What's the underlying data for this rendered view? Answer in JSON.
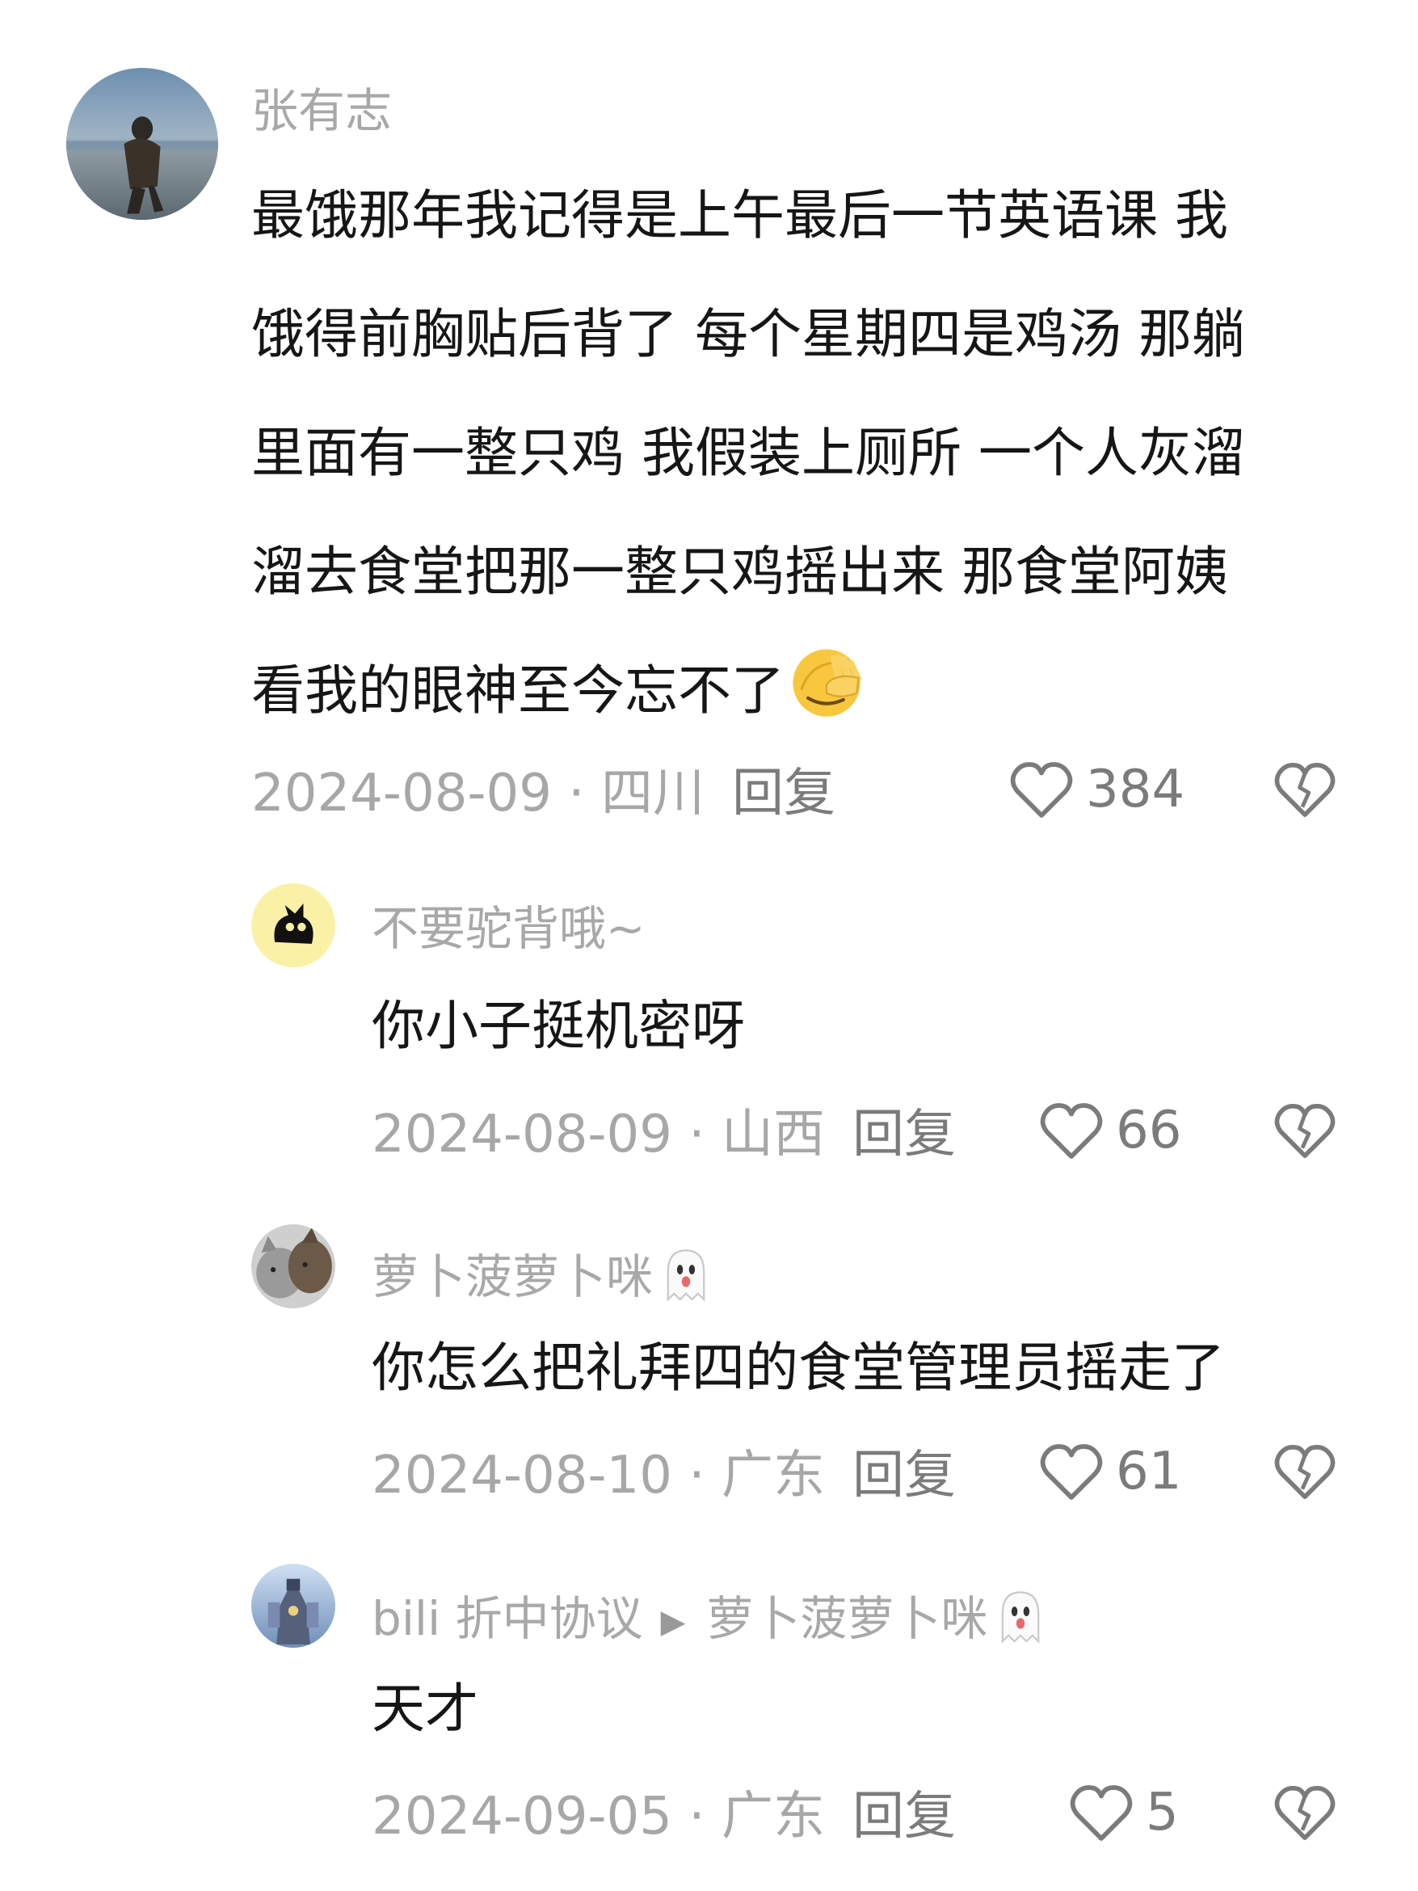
{
  "comments": [
    {
      "user": "张有志",
      "text_lines": [
        "最饿那年我记得是上午最后一节英语课  我",
        "饿得前胸贴后背了 每个星期四是鸡汤 那躺",
        "里面有一整只鸡 我假装上厕所 一个人灰溜",
        "溜去食堂把那一整只鸡摇出来 那食堂阿姨",
        "看我的眼神至今忘不了"
      ],
      "emoji": "face-with-hand-over-eyes-emoji",
      "meta": "2024-08-09 · 四川",
      "reply_label": "回复",
      "likes": "384"
    }
  ],
  "replies": [
    {
      "user": "不要驼背哦~",
      "text": "你小子挺机密呀",
      "meta": "2024-08-09 · 山西",
      "reply_label": "回复",
      "likes": "66"
    },
    {
      "user": "萝卜菠萝卜咪",
      "user_emoji": "ghost-emoji",
      "text": "你怎么把礼拜四的食堂管理员摇走了",
      "meta": "2024-08-10 · 广东",
      "reply_label": "回复",
      "likes": "61"
    },
    {
      "user": "bili 折中协议",
      "reply_to": "萝卜菠萝卜咪",
      "reply_to_emoji": "ghost-emoji",
      "text": "天才",
      "meta": "2024-09-05 · 广东",
      "reply_label": "回复",
      "likes": "5"
    }
  ],
  "icons": {
    "like": "heart-outline-icon",
    "dislike": "broken-heart-icon",
    "reply_arrow": "play-arrow-icon"
  },
  "colors": {
    "text": "#161616",
    "secondary": "#a8a8a8",
    "action": "#7b7b7b"
  }
}
